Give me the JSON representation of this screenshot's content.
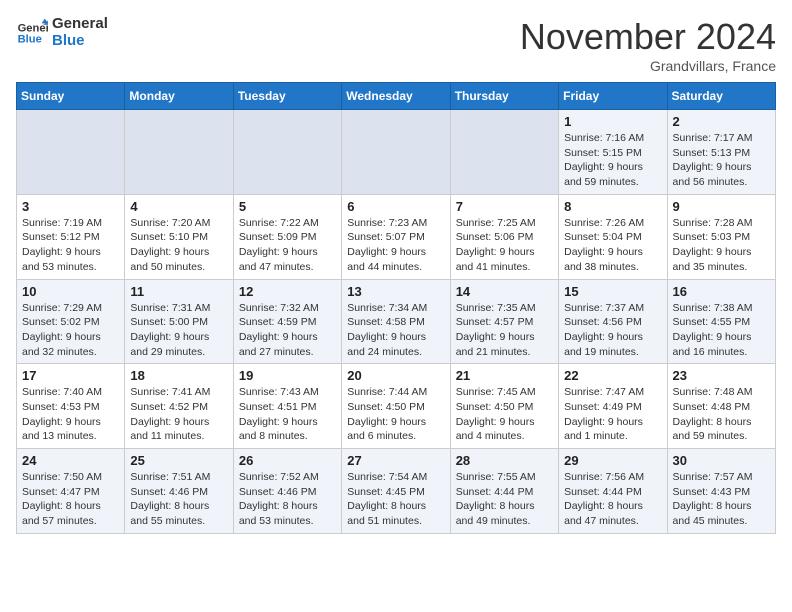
{
  "logo": {
    "line1": "General",
    "line2": "Blue"
  },
  "title": "November 2024",
  "location": "Grandvillars, France",
  "weekdays": [
    "Sunday",
    "Monday",
    "Tuesday",
    "Wednesday",
    "Thursday",
    "Friday",
    "Saturday"
  ],
  "weeks": [
    [
      {
        "day": "",
        "info": ""
      },
      {
        "day": "",
        "info": ""
      },
      {
        "day": "",
        "info": ""
      },
      {
        "day": "",
        "info": ""
      },
      {
        "day": "",
        "info": ""
      },
      {
        "day": "1",
        "info": "Sunrise: 7:16 AM\nSunset: 5:15 PM\nDaylight: 9 hours and 59 minutes."
      },
      {
        "day": "2",
        "info": "Sunrise: 7:17 AM\nSunset: 5:13 PM\nDaylight: 9 hours and 56 minutes."
      }
    ],
    [
      {
        "day": "3",
        "info": "Sunrise: 7:19 AM\nSunset: 5:12 PM\nDaylight: 9 hours and 53 minutes."
      },
      {
        "day": "4",
        "info": "Sunrise: 7:20 AM\nSunset: 5:10 PM\nDaylight: 9 hours and 50 minutes."
      },
      {
        "day": "5",
        "info": "Sunrise: 7:22 AM\nSunset: 5:09 PM\nDaylight: 9 hours and 47 minutes."
      },
      {
        "day": "6",
        "info": "Sunrise: 7:23 AM\nSunset: 5:07 PM\nDaylight: 9 hours and 44 minutes."
      },
      {
        "day": "7",
        "info": "Sunrise: 7:25 AM\nSunset: 5:06 PM\nDaylight: 9 hours and 41 minutes."
      },
      {
        "day": "8",
        "info": "Sunrise: 7:26 AM\nSunset: 5:04 PM\nDaylight: 9 hours and 38 minutes."
      },
      {
        "day": "9",
        "info": "Sunrise: 7:28 AM\nSunset: 5:03 PM\nDaylight: 9 hours and 35 minutes."
      }
    ],
    [
      {
        "day": "10",
        "info": "Sunrise: 7:29 AM\nSunset: 5:02 PM\nDaylight: 9 hours and 32 minutes."
      },
      {
        "day": "11",
        "info": "Sunrise: 7:31 AM\nSunset: 5:00 PM\nDaylight: 9 hours and 29 minutes."
      },
      {
        "day": "12",
        "info": "Sunrise: 7:32 AM\nSunset: 4:59 PM\nDaylight: 9 hours and 27 minutes."
      },
      {
        "day": "13",
        "info": "Sunrise: 7:34 AM\nSunset: 4:58 PM\nDaylight: 9 hours and 24 minutes."
      },
      {
        "day": "14",
        "info": "Sunrise: 7:35 AM\nSunset: 4:57 PM\nDaylight: 9 hours and 21 minutes."
      },
      {
        "day": "15",
        "info": "Sunrise: 7:37 AM\nSunset: 4:56 PM\nDaylight: 9 hours and 19 minutes."
      },
      {
        "day": "16",
        "info": "Sunrise: 7:38 AM\nSunset: 4:55 PM\nDaylight: 9 hours and 16 minutes."
      }
    ],
    [
      {
        "day": "17",
        "info": "Sunrise: 7:40 AM\nSunset: 4:53 PM\nDaylight: 9 hours and 13 minutes."
      },
      {
        "day": "18",
        "info": "Sunrise: 7:41 AM\nSunset: 4:52 PM\nDaylight: 9 hours and 11 minutes."
      },
      {
        "day": "19",
        "info": "Sunrise: 7:43 AM\nSunset: 4:51 PM\nDaylight: 9 hours and 8 minutes."
      },
      {
        "day": "20",
        "info": "Sunrise: 7:44 AM\nSunset: 4:50 PM\nDaylight: 9 hours and 6 minutes."
      },
      {
        "day": "21",
        "info": "Sunrise: 7:45 AM\nSunset: 4:50 PM\nDaylight: 9 hours and 4 minutes."
      },
      {
        "day": "22",
        "info": "Sunrise: 7:47 AM\nSunset: 4:49 PM\nDaylight: 9 hours and 1 minute."
      },
      {
        "day": "23",
        "info": "Sunrise: 7:48 AM\nSunset: 4:48 PM\nDaylight: 8 hours and 59 minutes."
      }
    ],
    [
      {
        "day": "24",
        "info": "Sunrise: 7:50 AM\nSunset: 4:47 PM\nDaylight: 8 hours and 57 minutes."
      },
      {
        "day": "25",
        "info": "Sunrise: 7:51 AM\nSunset: 4:46 PM\nDaylight: 8 hours and 55 minutes."
      },
      {
        "day": "26",
        "info": "Sunrise: 7:52 AM\nSunset: 4:46 PM\nDaylight: 8 hours and 53 minutes."
      },
      {
        "day": "27",
        "info": "Sunrise: 7:54 AM\nSunset: 4:45 PM\nDaylight: 8 hours and 51 minutes."
      },
      {
        "day": "28",
        "info": "Sunrise: 7:55 AM\nSunset: 4:44 PM\nDaylight: 8 hours and 49 minutes."
      },
      {
        "day": "29",
        "info": "Sunrise: 7:56 AM\nSunset: 4:44 PM\nDaylight: 8 hours and 47 minutes."
      },
      {
        "day": "30",
        "info": "Sunrise: 7:57 AM\nSunset: 4:43 PM\nDaylight: 8 hours and 45 minutes."
      }
    ]
  ]
}
